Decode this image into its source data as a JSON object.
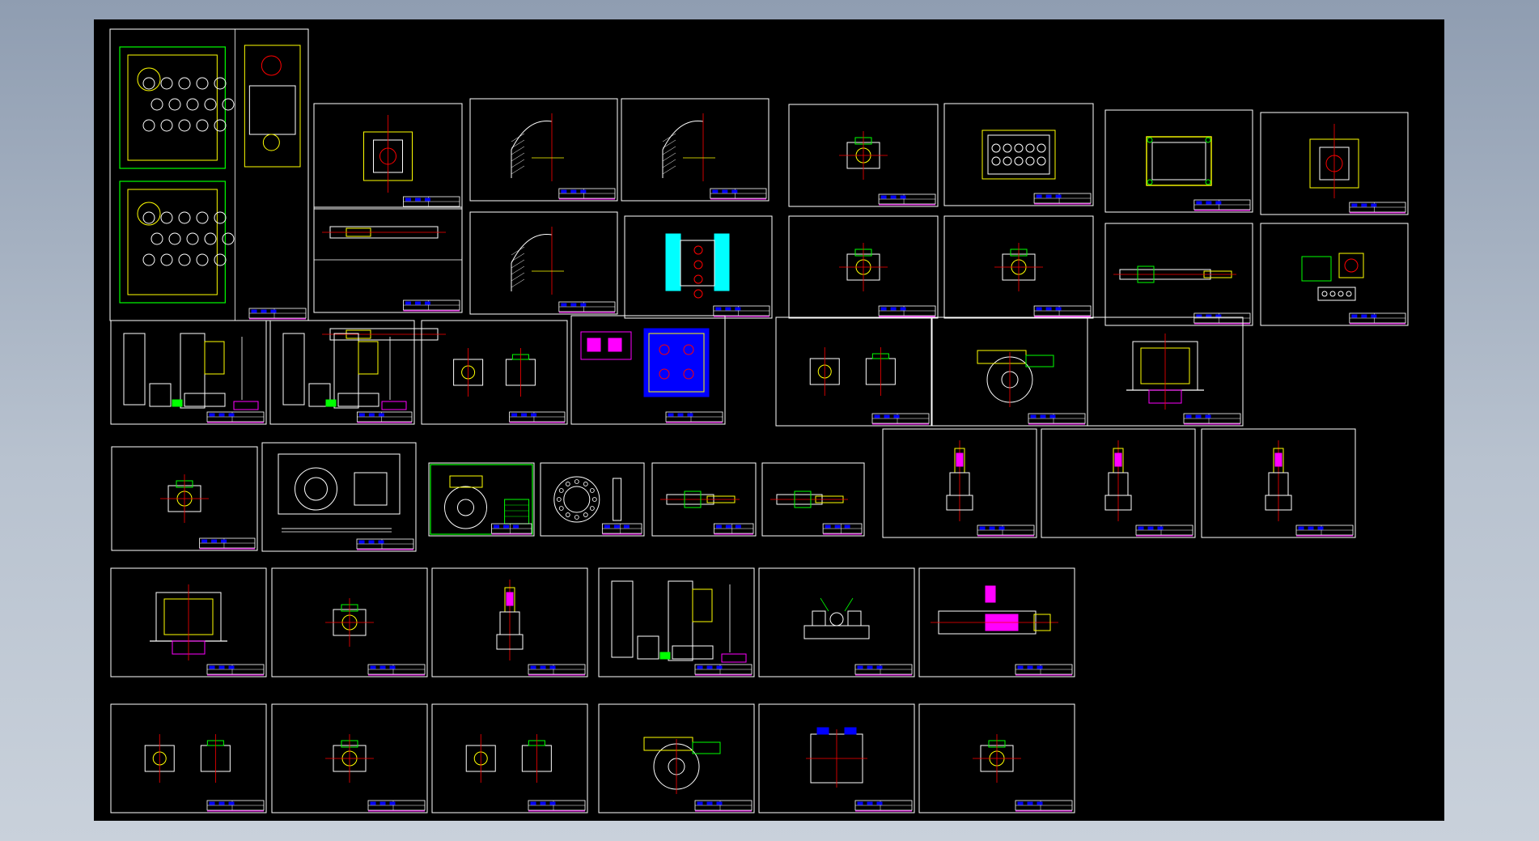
{
  "viewer": {
    "background_top": "#8f9db1",
    "background_bottom": "#c9d1db",
    "canvas_color": "#000000"
  },
  "drawing_palette": {
    "frame": "#ffffff",
    "main_lines": "#ffffff",
    "accent_yellow": "#ffff00",
    "accent_green": "#00ff00",
    "accent_red": "#ff0000",
    "accent_magenta": "#ff00ff",
    "accent_cyan": "#00ffff",
    "accent_blue": "#0000ff"
  },
  "sheets": [
    {
      "id": "s01",
      "motif": "two-plates-holes"
    },
    {
      "id": "s02",
      "motif": "side-view-stack"
    },
    {
      "id": "s03",
      "motif": "long-shaft-pair"
    },
    {
      "id": "s04",
      "motif": "section-curve"
    },
    {
      "id": "s05",
      "motif": "section-curve"
    },
    {
      "id": "s06",
      "motif": "section-curve"
    },
    {
      "id": "s07",
      "motif": "cyan-section"
    },
    {
      "id": "s08",
      "motif": "small-part"
    },
    {
      "id": "s09",
      "motif": "plate-holes"
    },
    {
      "id": "s10",
      "motif": "small-part"
    },
    {
      "id": "s11",
      "motif": "small-part"
    },
    {
      "id": "s12",
      "motif": "frame-plate"
    },
    {
      "id": "s13",
      "motif": "side-view-stack"
    },
    {
      "id": "s14",
      "motif": "long-shaft"
    },
    {
      "id": "s15",
      "motif": "assembly-colored"
    },
    {
      "id": "s16",
      "motif": "machine-column"
    },
    {
      "id": "s17",
      "motif": "machine-column"
    },
    {
      "id": "s18",
      "motif": "two-parts"
    },
    {
      "id": "s19",
      "motif": "assembly-blue"
    },
    {
      "id": "s20",
      "motif": "two-parts"
    },
    {
      "id": "s21",
      "motif": "rotary-part"
    },
    {
      "id": "s22",
      "motif": "frame-assembly"
    },
    {
      "id": "s23",
      "motif": "small-part"
    },
    {
      "id": "s24",
      "motif": "flange-view"
    },
    {
      "id": "s25",
      "motif": "wheel-green"
    },
    {
      "id": "s26",
      "motif": "wheel"
    },
    {
      "id": "s27",
      "motif": "long-shaft"
    },
    {
      "id": "s28",
      "motif": "long-shaft"
    },
    {
      "id": "s29",
      "motif": "vertical-tool"
    },
    {
      "id": "s30",
      "motif": "vertical-tool"
    },
    {
      "id": "s31",
      "motif": "vertical-tool"
    },
    {
      "id": "s32",
      "motif": "frame-assembly"
    },
    {
      "id": "s33",
      "motif": "small-part"
    },
    {
      "id": "s34",
      "motif": "vertical-tool"
    },
    {
      "id": "s35",
      "motif": "machine-column"
    },
    {
      "id": "s36",
      "motif": "fixture"
    },
    {
      "id": "s37",
      "motif": "magenta-shaft"
    },
    {
      "id": "s38",
      "motif": "two-parts"
    },
    {
      "id": "s39",
      "motif": "small-part"
    },
    {
      "id": "s40",
      "motif": "two-parts"
    },
    {
      "id": "s41",
      "motif": "rotary-part"
    },
    {
      "id": "s42",
      "motif": "square-plate"
    },
    {
      "id": "s43",
      "motif": "small-part"
    }
  ]
}
